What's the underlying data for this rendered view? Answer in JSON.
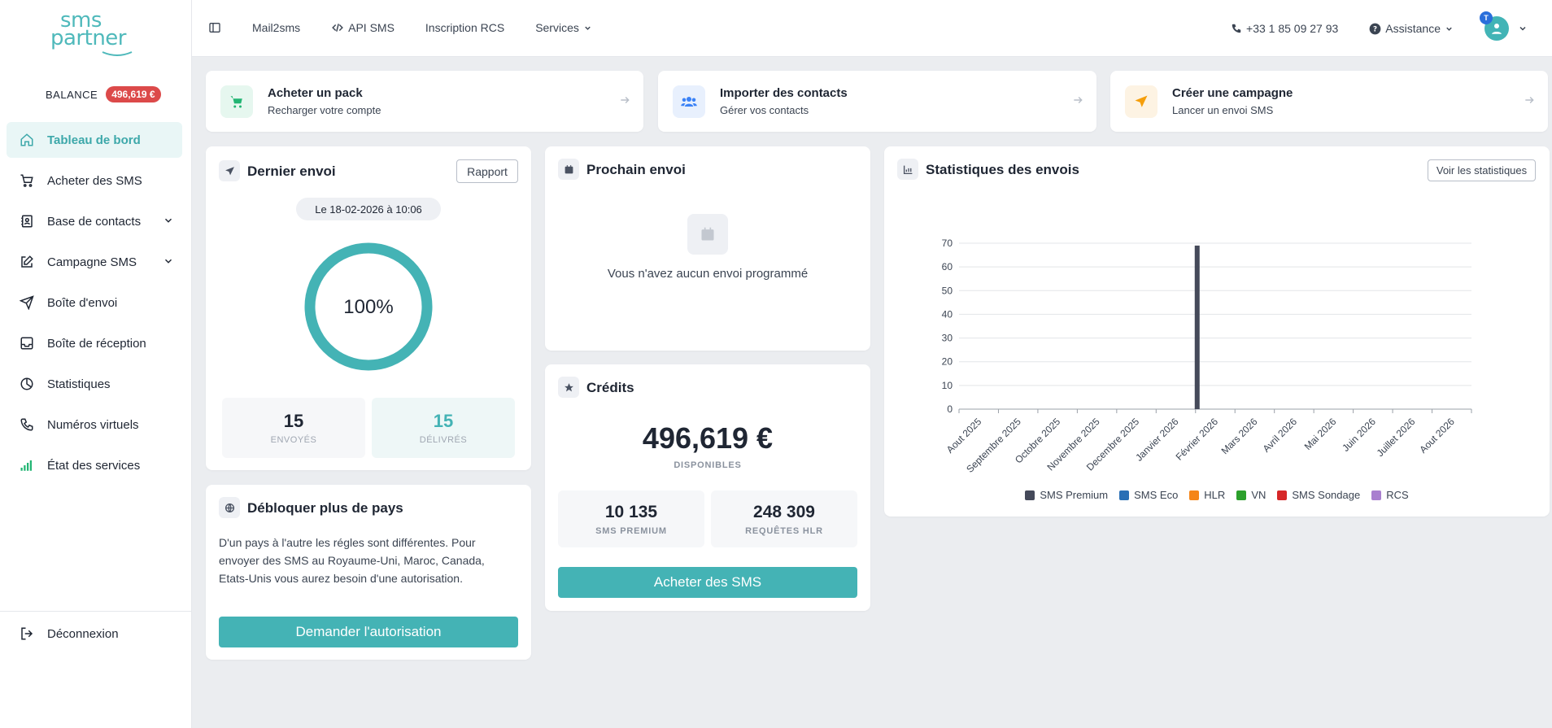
{
  "logo": {
    "line1": "sms",
    "line2": "partner"
  },
  "balance": {
    "label": "BALANCE",
    "value": "496,619 €"
  },
  "sidebar": {
    "items": [
      {
        "label": "Tableau de bord",
        "icon": "home-icon",
        "active": true
      },
      {
        "label": "Acheter des SMS",
        "icon": "cart-icon"
      },
      {
        "label": "Base de contacts",
        "icon": "contacts-book-icon",
        "expandable": true
      },
      {
        "label": "Campagne SMS",
        "icon": "edit-icon",
        "expandable": true
      },
      {
        "label": "Boîte d'envoi",
        "icon": "send-icon"
      },
      {
        "label": "Boîte de réception",
        "icon": "inbox-icon"
      },
      {
        "label": "Statistiques",
        "icon": "pie-chart-icon"
      },
      {
        "label": "Numéros virtuels",
        "icon": "phone-icon"
      },
      {
        "label": "État des services",
        "icon": "signal-bars-icon"
      }
    ],
    "logout": "Déconnexion"
  },
  "topbar": {
    "nav": {
      "mail2sms": "Mail2sms",
      "api": "API SMS",
      "rcs": "Inscription RCS",
      "services": "Services"
    },
    "phone": "+33 1 85 09 27 93",
    "assistance": "Assistance",
    "avatar_badge": "T"
  },
  "quick_actions": [
    {
      "title": "Acheter un pack",
      "subtitle": "Recharger votre compte",
      "icon": "cart-icon",
      "color": "#22b573",
      "bg": "#e6f7ef"
    },
    {
      "title": "Importer des contacts",
      "subtitle": "Gérer vos contacts",
      "icon": "users-icon",
      "color": "#3b82f6",
      "bg": "#e8f0fd"
    },
    {
      "title": "Créer une campagne",
      "subtitle": "Lancer un envoi SMS",
      "icon": "paper-plane-icon",
      "color": "#f59e0b",
      "bg": "#fdf3e3"
    }
  ],
  "last_send": {
    "title": "Dernier envoi",
    "report_button": "Rapport",
    "date": "Le 18-02-2026 à 10:06",
    "percent": "100%",
    "progress": 1.0,
    "sent": {
      "value": "15",
      "label": "ENVOYÉS"
    },
    "delivered": {
      "value": "15",
      "label": "DÉLIVRÉS"
    }
  },
  "next_send": {
    "title": "Prochain envoi",
    "empty_text": "Vous n'avez aucun envoi programmé"
  },
  "credits": {
    "title": "Crédits",
    "amount": "496,619 €",
    "amount_label": "DISPONIBLES",
    "premium": {
      "value": "10 135",
      "label": "SMS PREMIUM"
    },
    "hlr": {
      "value": "248 309",
      "label": "REQUÊTES HLR"
    },
    "buy_button": "Acheter des SMS"
  },
  "unlock": {
    "title": "Débloquer plus de pays",
    "text": "D'un pays à l'autre les régles sont différentes. Pour envoyer des SMS au Royaume-Uni, Maroc, Canada, Etats-Unis vous aurez besoin d'une autorisation.",
    "button": "Demander l'autorisation"
  },
  "stats_card": {
    "title": "Statistiques des envois",
    "button": "Voir les statistiques"
  },
  "chart_data": {
    "type": "bar",
    "title": "",
    "categories": [
      "Aout 2025",
      "Septembre 2025",
      "Octobre 2025",
      "Novembre 2025",
      "Decembre 2025",
      "Janvier 2026",
      "Février 2026",
      "Mars 2026",
      "Avril 2026",
      "Mai 2026",
      "Juin 2026",
      "Juillet 2026",
      "Aout 2026"
    ],
    "series": [
      {
        "name": "SMS Premium",
        "color": "#454a5a",
        "values": [
          0,
          0,
          0,
          0,
          0,
          0,
          69,
          0,
          0,
          0,
          0,
          0,
          0
        ]
      },
      {
        "name": "SMS Eco",
        "color": "#2a6fb5",
        "values": [
          0,
          0,
          0,
          0,
          0,
          0,
          0,
          0,
          0,
          0,
          0,
          0,
          0
        ]
      },
      {
        "name": "HLR",
        "color": "#f58518",
        "values": [
          0,
          0,
          0,
          0,
          0,
          0,
          0,
          0,
          0,
          0,
          0,
          0,
          0
        ]
      },
      {
        "name": "VN",
        "color": "#2ca02c",
        "values": [
          0,
          0,
          0,
          0,
          0,
          0,
          0,
          0,
          0,
          0,
          0,
          0,
          0
        ]
      },
      {
        "name": "SMS Sondage",
        "color": "#d62728",
        "values": [
          0,
          0,
          0,
          0,
          0,
          0,
          0,
          0,
          0,
          0,
          0,
          0,
          0
        ]
      },
      {
        "name": "RCS",
        "color": "#a97fcf",
        "values": [
          0,
          0,
          0,
          0,
          0,
          0,
          0,
          0,
          0,
          0,
          0,
          0,
          0
        ]
      }
    ],
    "yticks": [
      "0",
      "10",
      "20",
      "30",
      "40",
      "50",
      "60",
      "70"
    ],
    "ylim": [
      0,
      70
    ],
    "grid": true,
    "legend": "bottom"
  }
}
